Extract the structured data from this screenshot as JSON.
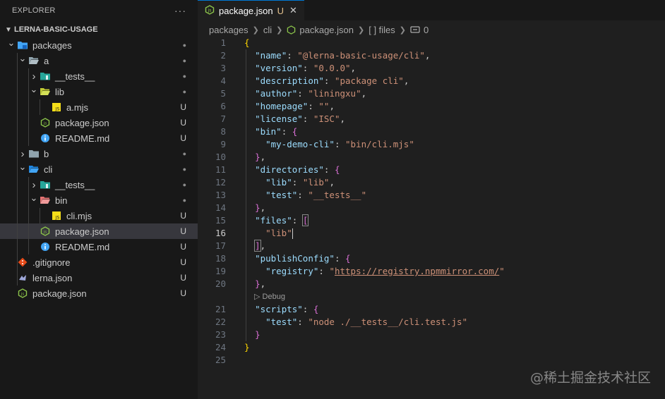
{
  "sidebar": {
    "title": "EXPLORER",
    "more": "···",
    "root": "LERNA-BASIC-USAGE",
    "items": [
      {
        "label": "packages",
        "depth": 1,
        "kind": "folder",
        "icon": "packages-folder-icon",
        "chev": "down",
        "status": "●"
      },
      {
        "label": "a",
        "depth": 2,
        "kind": "folder",
        "icon": "folder-open-icon",
        "chev": "down",
        "status": "●"
      },
      {
        "label": "__tests__",
        "depth": 3,
        "kind": "folder",
        "icon": "tests-folder-icon",
        "chev": "right",
        "status": "●"
      },
      {
        "label": "lib",
        "depth": 3,
        "kind": "folder",
        "icon": "lib-folder-icon",
        "chev": "down",
        "status": "●"
      },
      {
        "label": "a.mjs",
        "depth": 4,
        "kind": "file",
        "icon": "js-file-icon",
        "status": "U"
      },
      {
        "label": "package.json",
        "depth": 3,
        "kind": "file",
        "icon": "node-json-icon",
        "status": "U"
      },
      {
        "label": "README.md",
        "depth": 3,
        "kind": "file",
        "icon": "info-icon",
        "status": "U"
      },
      {
        "label": "b",
        "depth": 2,
        "kind": "folder",
        "icon": "folder-icon",
        "chev": "right",
        "status": "●"
      },
      {
        "label": "cli",
        "depth": 2,
        "kind": "folder",
        "icon": "cli-folder-icon",
        "chev": "down",
        "status": "●"
      },
      {
        "label": "__tests__",
        "depth": 3,
        "kind": "folder",
        "icon": "tests-folder-icon",
        "chev": "right",
        "status": "●"
      },
      {
        "label": "bin",
        "depth": 3,
        "kind": "folder",
        "icon": "bin-folder-icon",
        "chev": "down",
        "status": "●"
      },
      {
        "label": "cli.mjs",
        "depth": 4,
        "kind": "file",
        "icon": "js-file-icon",
        "status": "U"
      },
      {
        "label": "package.json",
        "depth": 3,
        "kind": "file",
        "icon": "node-json-icon",
        "status": "U",
        "selected": true
      },
      {
        "label": "README.md",
        "depth": 3,
        "kind": "file",
        "icon": "info-icon",
        "status": "U"
      },
      {
        "label": ".gitignore",
        "depth": 1,
        "kind": "file",
        "icon": "git-icon",
        "status": "U"
      },
      {
        "label": "lerna.json",
        "depth": 1,
        "kind": "file",
        "icon": "lerna-icon",
        "status": "U"
      },
      {
        "label": "package.json",
        "depth": 1,
        "kind": "file",
        "icon": "node-json-icon",
        "status": "U"
      }
    ]
  },
  "tab": {
    "name": "package.json",
    "status": "U",
    "close": "✕"
  },
  "breadcrumb": [
    "packages",
    "cli",
    "package.json",
    "[ ] files",
    "0"
  ],
  "code": {
    "active_line": 16,
    "debug_label": "Debug",
    "lines": [
      {
        "n": 1
      },
      {
        "n": 2
      },
      {
        "n": 3
      },
      {
        "n": 4
      },
      {
        "n": 5
      },
      {
        "n": 6
      },
      {
        "n": 7
      },
      {
        "n": 8
      },
      {
        "n": 9
      },
      {
        "n": 10
      },
      {
        "n": 11
      },
      {
        "n": 12
      },
      {
        "n": 13
      },
      {
        "n": 14
      },
      {
        "n": 15
      },
      {
        "n": 16
      },
      {
        "n": 17
      },
      {
        "n": 18
      },
      {
        "n": 19
      },
      {
        "n": 20
      },
      {
        "n": 21
      },
      {
        "n": 22
      },
      {
        "n": 23
      },
      {
        "n": 24
      },
      {
        "n": 25
      }
    ],
    "values": {
      "name_key": "\"name\"",
      "name_val": "\"@lerna-basic-usage/cli\"",
      "version_key": "\"version\"",
      "version_val": "\"0.0.0\"",
      "description_key": "\"description\"",
      "description_val": "\"package cli\"",
      "author_key": "\"author\"",
      "author_val": "\"liningxu\"",
      "homepage_key": "\"homepage\"",
      "homepage_val": "\"\"",
      "license_key": "\"license\"",
      "license_val": "\"ISC\"",
      "bin_key": "\"bin\"",
      "mydemo_key": "\"my-demo-cli\"",
      "mydemo_val": "\"bin/cli.mjs\"",
      "directories_key": "\"directories\"",
      "lib_key": "\"lib\"",
      "lib_val": "\"lib\"",
      "test_key": "\"test\"",
      "test_val": "\"__tests__\"",
      "files_key": "\"files\"",
      "files_item": "\"lib\"",
      "publish_key": "\"publishConfig\"",
      "registry_key": "\"registry\"",
      "registry_val": "https://registry.npmmirror.com/",
      "scripts_key": "\"scripts\"",
      "script_test_key": "\"test\"",
      "script_test_val": "\"node ./__tests__/cli.test.js\""
    }
  },
  "watermark": "@稀土掘金技术社区",
  "colors": {
    "accent": "#0078d4",
    "key": "#9cdcfe",
    "string": "#ce9178",
    "brace1": "#ffd700",
    "brace2": "#da70d6",
    "untracked": "#e2c08d"
  }
}
